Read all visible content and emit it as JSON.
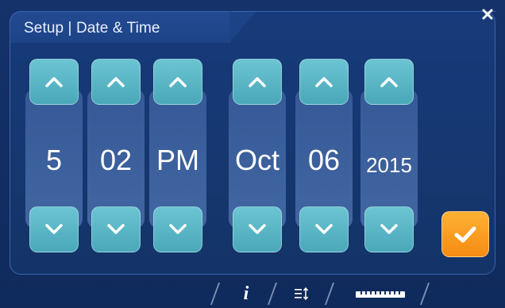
{
  "header": {
    "title": "Setup | Date & Time",
    "close_icon": "close-icon"
  },
  "pickers": [
    {
      "id": "hour",
      "value": "5"
    },
    {
      "id": "minute",
      "value": "02"
    },
    {
      "id": "ampm",
      "value": "PM"
    },
    {
      "id": "month",
      "value": "Oct"
    },
    {
      "id": "day",
      "value": "06"
    },
    {
      "id": "year",
      "value": "2015"
    }
  ],
  "controls": {
    "up_icon": "chevron-up-icon",
    "down_icon": "chevron-down-icon",
    "confirm_icon": "checkmark-icon"
  },
  "bottom_bar": {
    "info_label": "i",
    "icons": [
      "info-icon",
      "list-sort-icon",
      "ruler-icon"
    ]
  },
  "colors": {
    "background": "#15326b",
    "panel": "#173a7a",
    "stepper": "#5fb8c8",
    "confirm": "#f79a1f",
    "text": "#ffffff"
  }
}
